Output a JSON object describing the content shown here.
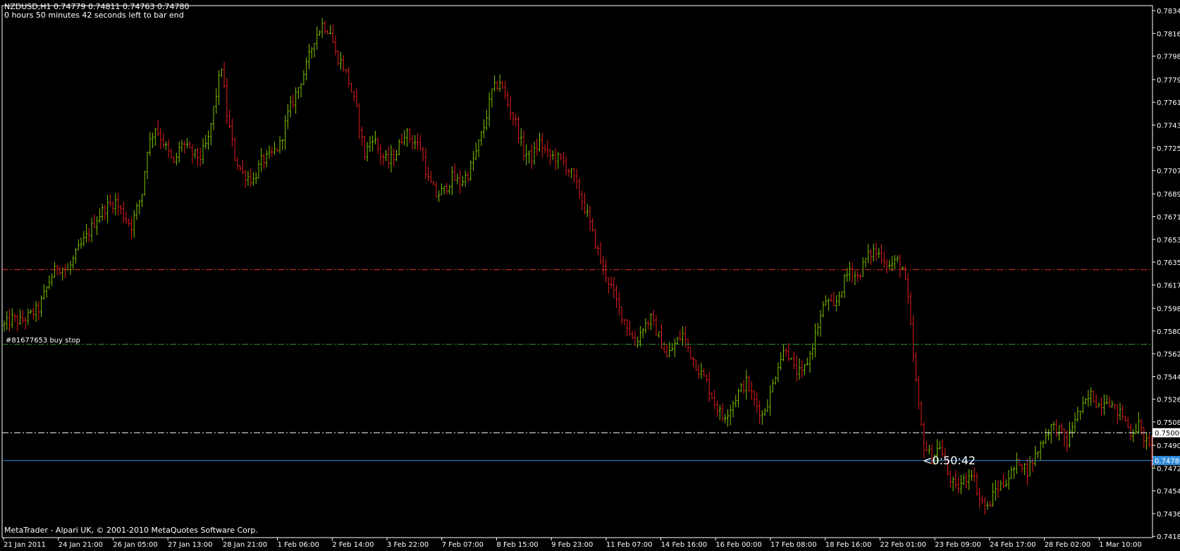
{
  "header": {
    "symbol_line": "NZDUSD,H1  0.74779 0.74811 0.74763 0.74780",
    "timer_line": "0 hours 50 minutes 42 seconds left to bar end"
  },
  "footer": {
    "copyright": "MetaTrader - Alpari UK, © 2001-2010 MetaQuotes Software Corp."
  },
  "countdown": "<0:50:42",
  "order_label": "#81677653 buy stop",
  "colors": {
    "background": "#000000",
    "bull": "#7fc400",
    "bear": "#e41c1c",
    "axis": "#ffffff",
    "bid_line": "#2e8bd8",
    "order_line_red": "#e83020",
    "order_line_green": "#2e9c2e",
    "order_line_white": "#ffffff"
  },
  "chart_data": {
    "type": "ohlc",
    "symbol": "NZDUSD",
    "timeframe": "H1",
    "ylim": [
      0.7417,
      0.7838
    ],
    "y_ticks": [
      "0.78340",
      "0.78160",
      "0.77980",
      "0.77795",
      "0.77615",
      "0.77435",
      "0.77255",
      "0.77075",
      "0.76890",
      "0.76710",
      "0.76530",
      "0.76350",
      "0.76170",
      "0.75985",
      "0.75805",
      "0.75625",
      "0.75444",
      "0.75265",
      "0.75085",
      "0.74900",
      "0.74720",
      "0.74540",
      "0.74360",
      "0.74180"
    ],
    "x_ticks": [
      "21 Jan 2011",
      "24 Jan 21:00",
      "26 Jan 05:00",
      "27 Jan 13:00",
      "28 Jan 21:00",
      "1 Feb 06:00",
      "2 Feb 14:00",
      "3 Feb 22:00",
      "7 Feb 07:00",
      "8 Feb 15:00",
      "9 Feb 23:00",
      "11 Feb 07:00",
      "14 Feb 16:00",
      "16 Feb 00:00",
      "17 Feb 08:00",
      "18 Feb 16:00",
      "22 Feb 01:00",
      "23 Feb 09:00",
      "24 Feb 17:00",
      "28 Feb 02:00",
      "1 Mar 10:00"
    ],
    "price_path": [
      [
        0,
        0.7585
      ],
      [
        3,
        0.759
      ],
      [
        6,
        0.7588
      ],
      [
        9,
        0.7592
      ],
      [
        13,
        0.7598
      ],
      [
        17,
        0.762
      ],
      [
        20,
        0.7632
      ],
      [
        24,
        0.7628
      ],
      [
        28,
        0.7645
      ],
      [
        31,
        0.7655
      ],
      [
        35,
        0.767
      ],
      [
        38,
        0.7678
      ],
      [
        42,
        0.7683
      ],
      [
        45,
        0.7672
      ],
      [
        48,
        0.7664
      ],
      [
        52,
        0.769
      ],
      [
        54,
        0.7725
      ],
      [
        57,
        0.7742
      ],
      [
        60,
        0.773
      ],
      [
        64,
        0.7712
      ],
      [
        67,
        0.773
      ],
      [
        70,
        0.7722
      ],
      [
        74,
        0.7718
      ],
      [
        77,
        0.7732
      ],
      [
        80,
        0.7768
      ],
      [
        82,
        0.779
      ],
      [
        84,
        0.7752
      ],
      [
        87,
        0.7718
      ],
      [
        90,
        0.7705
      ],
      [
        94,
        0.77
      ],
      [
        97,
        0.7715
      ],
      [
        100,
        0.7718
      ],
      [
        104,
        0.7728
      ],
      [
        107,
        0.7752
      ],
      [
        110,
        0.7768
      ],
      [
        114,
        0.779
      ],
      [
        117,
        0.7812
      ],
      [
        120,
        0.7823
      ],
      [
        123,
        0.7818
      ],
      [
        125,
        0.78
      ],
      [
        128,
        0.779
      ],
      [
        130,
        0.7778
      ],
      [
        133,
        0.7755
      ],
      [
        136,
        0.772
      ],
      [
        139,
        0.7735
      ],
      [
        142,
        0.772
      ],
      [
        145,
        0.7714
      ],
      [
        148,
        0.7722
      ],
      [
        151,
        0.7738
      ],
      [
        154,
        0.7732
      ],
      [
        157,
        0.7726
      ],
      [
        160,
        0.77
      ],
      [
        163,
        0.7688
      ],
      [
        166,
        0.7692
      ],
      [
        169,
        0.7702
      ],
      [
        172,
        0.7698
      ],
      [
        175,
        0.7705
      ],
      [
        178,
        0.7722
      ],
      [
        181,
        0.7742
      ],
      [
        184,
        0.777
      ],
      [
        187,
        0.7778
      ],
      [
        190,
        0.776
      ],
      [
        193,
        0.7745
      ],
      [
        196,
        0.7722
      ],
      [
        199,
        0.7718
      ],
      [
        202,
        0.773
      ],
      [
        205,
        0.772
      ],
      [
        208,
        0.7718
      ],
      [
        211,
        0.7714
      ],
      [
        214,
        0.7705
      ],
      [
        217,
        0.769
      ],
      [
        220,
        0.7672
      ],
      [
        223,
        0.765
      ],
      [
        226,
        0.763
      ],
      [
        229,
        0.7615
      ],
      [
        232,
        0.7598
      ],
      [
        235,
        0.7585
      ],
      [
        238,
        0.757
      ],
      [
        241,
        0.7584
      ],
      [
        244,
        0.759
      ],
      [
        247,
        0.7576
      ],
      [
        250,
        0.756
      ],
      [
        253,
        0.757
      ],
      [
        256,
        0.7578
      ],
      [
        259,
        0.7562
      ],
      [
        262,
        0.755
      ],
      [
        265,
        0.754
      ],
      [
        268,
        0.7524
      ],
      [
        271,
        0.7512
      ],
      [
        274,
        0.752
      ],
      [
        277,
        0.7532
      ],
      [
        280,
        0.754
      ],
      [
        283,
        0.7525
      ],
      [
        286,
        0.7514
      ],
      [
        289,
        0.753
      ],
      [
        292,
        0.7555
      ],
      [
        295,
        0.7568
      ],
      [
        298,
        0.755
      ],
      [
        301,
        0.7546
      ],
      [
        304,
        0.7562
      ],
      [
        307,
        0.7585
      ],
      [
        310,
        0.7605
      ],
      [
        313,
        0.7598
      ],
      [
        316,
        0.7615
      ],
      [
        319,
        0.763
      ],
      [
        322,
        0.7623
      ],
      [
        325,
        0.7637
      ],
      [
        328,
        0.7644
      ],
      [
        331,
        0.764
      ],
      [
        334,
        0.7632
      ],
      [
        337,
        0.7636
      ],
      [
        339,
        0.763
      ],
      [
        341,
        0.7605
      ],
      [
        343,
        0.756
      ],
      [
        345,
        0.752
      ],
      [
        347,
        0.749
      ],
      [
        350,
        0.748
      ],
      [
        353,
        0.749
      ],
      [
        356,
        0.7468
      ],
      [
        359,
        0.7455
      ],
      [
        362,
        0.7462
      ],
      [
        365,
        0.747
      ],
      [
        368,
        0.7448
      ],
      [
        371,
        0.744
      ],
      [
        374,
        0.7455
      ],
      [
        377,
        0.746
      ],
      [
        380,
        0.7468
      ],
      [
        383,
        0.7478
      ],
      [
        386,
        0.747
      ],
      [
        389,
        0.7482
      ],
      [
        392,
        0.7495
      ],
      [
        395,
        0.7505
      ],
      [
        398,
        0.7502
      ],
      [
        401,
        0.7492
      ],
      [
        404,
        0.7512
      ],
      [
        407,
        0.752
      ],
      [
        410,
        0.753
      ],
      [
        413,
        0.7522
      ],
      [
        416,
        0.7528
      ],
      [
        419,
        0.7518
      ],
      [
        422,
        0.7514
      ],
      [
        425,
        0.75
      ],
      [
        428,
        0.7506
      ],
      [
        431,
        0.7492
      ],
      [
        434,
        0.7478
      ]
    ],
    "bars": 435,
    "horizontal_lines": [
      {
        "price": 0.7629,
        "style": "dash-dot",
        "color": "#e83020"
      },
      {
        "price": 0.757,
        "style": "dash-dot",
        "color": "#2e9c2e"
      },
      {
        "price": 0.75,
        "style": "dash-dot",
        "color": "#ffffff"
      },
      {
        "price": 0.7478,
        "style": "solid",
        "color": "#2e8bd8"
      }
    ],
    "price_labels": [
      "0.75000",
      "0.74780"
    ]
  }
}
